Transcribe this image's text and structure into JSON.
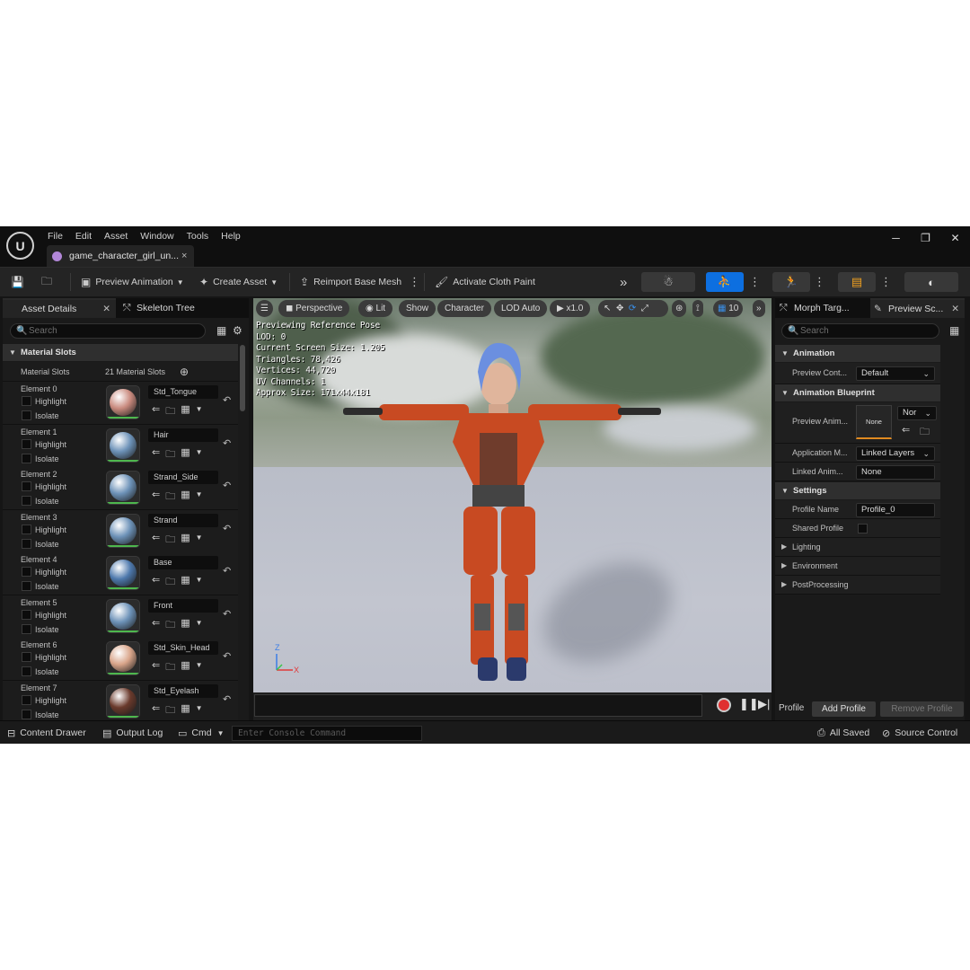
{
  "menu": [
    "File",
    "Edit",
    "Asset",
    "Window",
    "Tools",
    "Help"
  ],
  "tab": {
    "label": "game_character_girl_un...",
    "close": "×"
  },
  "window_controls": [
    "─",
    "❐",
    "✕"
  ],
  "toolbar": {
    "preview_animation": "Preview Animation",
    "create_asset": "Create Asset",
    "reimport": "Reimport Base Mesh",
    "cloth_paint": "Activate Cloth Paint",
    "more": "»"
  },
  "left_panel": {
    "tab_asset_details": "Asset Details",
    "tab_skeleton_tree": "Skeleton Tree",
    "search_placeholder": "Search",
    "section": "Material Slots",
    "slots_label": "Material Slots",
    "slots_count": "21 Material Slots",
    "highlight": "Highlight",
    "isolate": "Isolate",
    "elements": [
      {
        "label": "Element 0",
        "material": "Std_Tongue",
        "color": "#c98a7e"
      },
      {
        "label": "Element 1",
        "material": "Hair",
        "color": "#6d92b8"
      },
      {
        "label": "Element 2",
        "material": "Strand_Side",
        "color": "#6d92b8"
      },
      {
        "label": "Element 3",
        "material": "Strand",
        "color": "#6d92b8"
      },
      {
        "label": "Element 4",
        "material": "Base",
        "color": "#4e79ad"
      },
      {
        "label": "Element 5",
        "material": "Front",
        "color": "#6d92b8"
      },
      {
        "label": "Element 6",
        "material": "Std_Skin_Head",
        "color": "#d9a58a"
      },
      {
        "label": "Element 7",
        "material": "Std_Eyelash",
        "color": "#6a3a2c"
      }
    ]
  },
  "viewport": {
    "perspective": "Perspective",
    "lit": "Lit",
    "show": "Show",
    "character": "Character",
    "lod": "LOD Auto",
    "speed": "x1.0",
    "grid_value": "10",
    "stats": [
      "Previewing Reference Pose",
      "LOD: 0",
      "Current Screen Size: 1.205",
      "Triangles: 78,426",
      "Vertices: 44,720",
      "UV Channels: 1",
      "Approx Size: 171x44x181"
    ],
    "axis_z": "Z",
    "axis_x": "X"
  },
  "right_panel": {
    "tab_morph": "Morph Targ...",
    "tab_preview": "Preview Sc...",
    "search_placeholder": "Search",
    "sec_animation": "Animation",
    "preview_controller_label": "Preview Cont...",
    "preview_controller_value": "Default",
    "sec_anim_bp": "Animation Blueprint",
    "preview_anim_label": "Preview Anim...",
    "preview_anim_value": "None",
    "preview_anim_dd": "Nor",
    "app_mode_label": "Application M...",
    "app_mode_value": "Linked Layers",
    "linked_anim_label": "Linked Anim...",
    "linked_anim_value": "None",
    "sec_settings": "Settings",
    "profile_name_label": "Profile Name",
    "profile_name_value": "Profile_0",
    "shared_profile_label": "Shared Profile",
    "lighting": "Lighting",
    "environment": "Environment",
    "postprocessing": "PostProcessing",
    "profile": "Profile",
    "add_profile": "Add Profile",
    "remove_profile": "Remove Profile"
  },
  "statusbar": {
    "content_drawer": "Content Drawer",
    "output_log": "Output Log",
    "cmd": "Cmd",
    "console_placeholder": "Enter Console Command",
    "all_saved": "All Saved",
    "source_control": "Source Control"
  },
  "colors": {
    "accent_blue": "#0d6fe0",
    "record_red": "#e03030",
    "bg": "#151515"
  }
}
